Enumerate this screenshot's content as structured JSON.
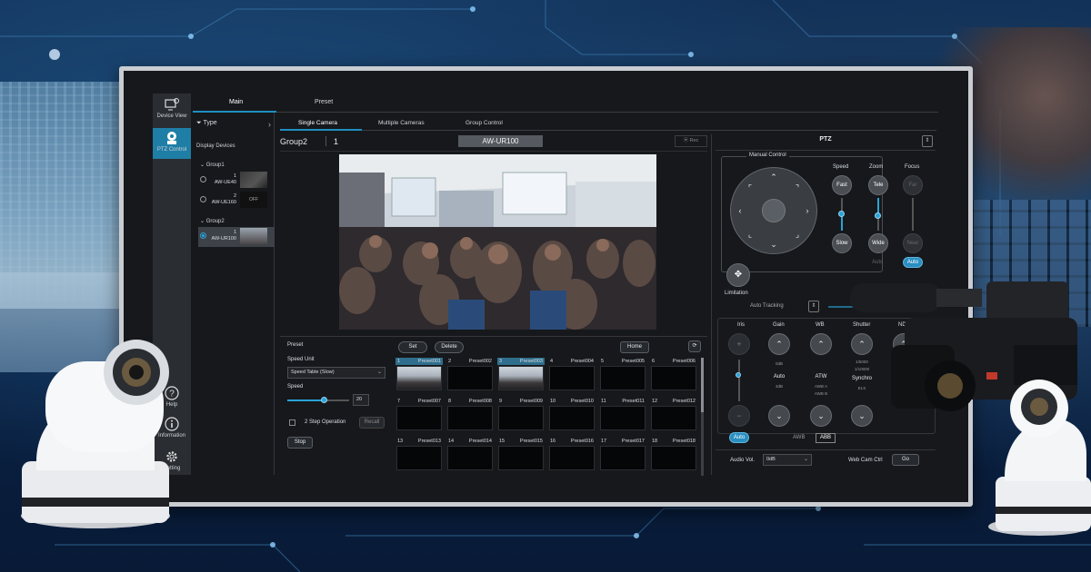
{
  "nav": {
    "items": [
      {
        "label": "Device View",
        "icon": "monitor-camera-icon",
        "active": false
      },
      {
        "label": "PTZ Control",
        "icon": "ptz-camera-icon",
        "active": true
      },
      {
        "label": "Help",
        "icon": "help-icon",
        "active": false
      },
      {
        "label": "Information",
        "icon": "info-icon",
        "active": false
      },
      {
        "label": "Setting",
        "icon": "gear-icon",
        "active": false
      }
    ]
  },
  "top_tabs": [
    "Main",
    "Preset"
  ],
  "left_panel": {
    "type_label": "Type",
    "display_devices_label": "Display Devices",
    "groups": [
      {
        "name": "Group1",
        "cameras": [
          {
            "index": "1",
            "name": "AW-UE40",
            "thumb": ""
          },
          {
            "index": "2",
            "name": "AW-UE160",
            "thumb": "OFF"
          }
        ]
      },
      {
        "name": "Group2",
        "cameras": [
          {
            "index": "1",
            "name": "AW-UR100",
            "thumb": ""
          }
        ]
      }
    ]
  },
  "sub_tabs": [
    "Single Camera",
    "Multiple Cameras",
    "Group Control"
  ],
  "preview": {
    "group": "Group2",
    "number": "1",
    "camera_name": "AW-UR100",
    "rec_label": "Rec"
  },
  "preset": {
    "title": "Preset",
    "speed_unit_label": "Speed Unit",
    "speed_unit_value": "Speed Table (Slow)",
    "speed_label": "Speed",
    "speed_value": "20",
    "speed_fraction": 0.6,
    "two_step_label": "2 Step Operation",
    "recall_label": "Recall",
    "stop_label": "Stop",
    "set_label": "Set",
    "delete_label": "Delete",
    "home_label": "Home",
    "items": [
      {
        "n": "1",
        "name": "Preset001",
        "thumb": true
      },
      {
        "n": "2",
        "name": "Preset002",
        "thumb": false
      },
      {
        "n": "3",
        "name": "Preset003",
        "thumb": true
      },
      {
        "n": "4",
        "name": "Preset004",
        "thumb": false
      },
      {
        "n": "5",
        "name": "Preset005",
        "thumb": false
      },
      {
        "n": "6",
        "name": "Preset006",
        "thumb": false
      },
      {
        "n": "7",
        "name": "Preset007",
        "thumb": false
      },
      {
        "n": "8",
        "name": "Preset008",
        "thumb": false
      },
      {
        "n": "9",
        "name": "Preset009",
        "thumb": false
      },
      {
        "n": "10",
        "name": "Preset010",
        "thumb": false
      },
      {
        "n": "11",
        "name": "Preset011",
        "thumb": false
      },
      {
        "n": "12",
        "name": "Preset012",
        "thumb": false
      },
      {
        "n": "13",
        "name": "Preset013",
        "thumb": false
      },
      {
        "n": "14",
        "name": "Preset014",
        "thumb": false
      },
      {
        "n": "15",
        "name": "Preset015",
        "thumb": false
      },
      {
        "n": "16",
        "name": "Preset016",
        "thumb": false
      },
      {
        "n": "17",
        "name": "Preset017",
        "thumb": false
      },
      {
        "n": "18",
        "name": "Preset018",
        "thumb": false
      }
    ]
  },
  "ptz": {
    "title": "PTZ",
    "manual_control": "Manual Control",
    "speed_label": "Speed",
    "zoom_label": "Zoom",
    "focus_label": "Focus",
    "fast": "Fast",
    "slow": "Slow",
    "tele": "Tele",
    "wide": "Wide",
    "far": "Far",
    "near": "Near",
    "auto": "Auto",
    "limitation": "Limitation",
    "auto_tracking": "Auto Tracking",
    "iris": "Iris",
    "gain": "Gain",
    "wb": "WB",
    "shutter": "Shutter",
    "nd": "ND",
    "gain_value": "Auto",
    "gain_sub": "0dB",
    "gain_sub2": "3dB",
    "wb_value": "ATW",
    "wb_sub": "AWB A",
    "wb_sub2": "AWB B",
    "shutter_value": "Synchro",
    "shutter_sub": "1/5000",
    "shutter_sub2": "1/10000",
    "shutter_sub3": "ELS",
    "awb_label": "AWB",
    "abb_label": "ABB",
    "audio_vol_label": "Audio Vol.",
    "audio_vol_value": "0dB",
    "web_cam_label": "Web Cam Ctrl",
    "go_label": "Go"
  },
  "colors": {
    "accent": "#2aa3d8",
    "active_nav": "#1f7ea6",
    "panel_bg": "#16181b"
  }
}
